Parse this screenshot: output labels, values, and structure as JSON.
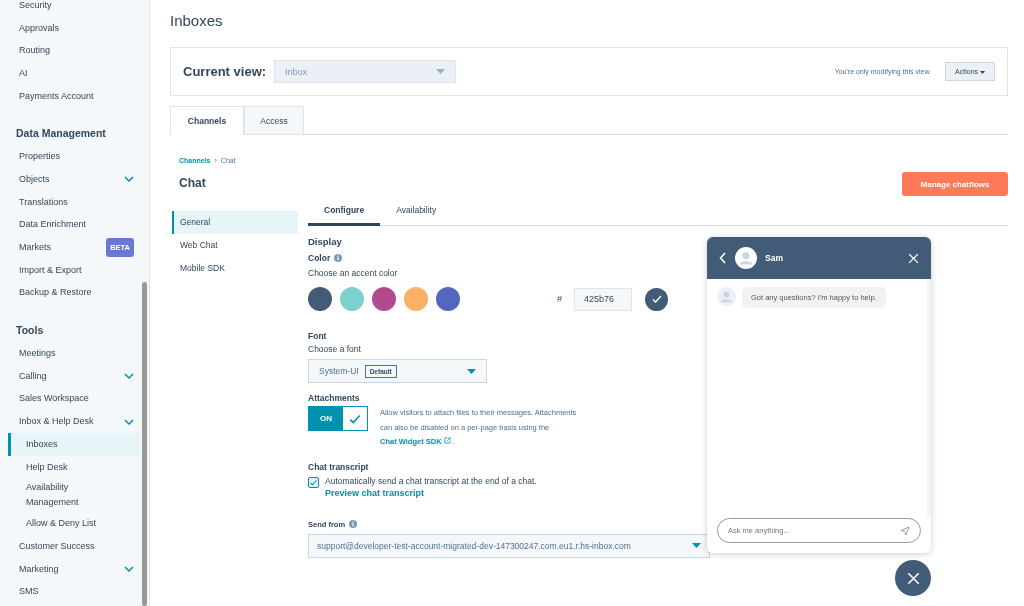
{
  "sidebar": {
    "sections": [
      {
        "items": [
          {
            "label": "Security",
            "expandable": false,
            "selected": false
          },
          {
            "label": "Approvals",
            "expandable": false,
            "selected": false
          },
          {
            "label": "Routing",
            "expandable": false,
            "selected": false
          },
          {
            "label": "AI",
            "expandable": false,
            "selected": false
          },
          {
            "label": "Payments Account",
            "expandable": false,
            "selected": false
          }
        ]
      },
      {
        "heading": "Data Management",
        "items": [
          {
            "label": "Properties",
            "expandable": false,
            "selected": false
          },
          {
            "label": "Objects",
            "expandable": true,
            "selected": false
          },
          {
            "label": "Translations",
            "expandable": false,
            "selected": false
          },
          {
            "label": "Data Enrichment",
            "expandable": false,
            "selected": false
          },
          {
            "label": "Markets",
            "badge": "BETA",
            "expandable": false,
            "selected": false
          },
          {
            "label": "Import & Export",
            "expandable": false,
            "selected": false
          },
          {
            "label": "Backup & Restore",
            "expandable": false,
            "selected": false
          }
        ]
      },
      {
        "heading": "Tools",
        "items": [
          {
            "label": "Meetings",
            "expandable": false,
            "selected": false
          },
          {
            "label": "Calling",
            "expandable": true,
            "selected": false
          },
          {
            "label": "Sales Workspace",
            "expandable": false,
            "selected": false
          },
          {
            "label": "Inbox & Help Desk",
            "expandable": true,
            "selected": false,
            "children": [
              {
                "label": "Inboxes",
                "selected": true
              },
              {
                "label": "Help Desk",
                "selected": false
              },
              {
                "label": "Availability Management",
                "selected": false
              },
              {
                "label": "Allow & Deny List",
                "selected": false
              }
            ]
          },
          {
            "label": "Customer Success",
            "expandable": false,
            "selected": false
          },
          {
            "label": "Marketing",
            "expandable": true,
            "selected": false
          },
          {
            "label": "SMS",
            "expandable": false,
            "selected": false
          }
        ]
      }
    ]
  },
  "page_title": "Inboxes",
  "view_bar": {
    "label": "Current view:",
    "select_value": "Inbox",
    "note": "You're only modifying this view.",
    "actions": "Actions"
  },
  "tabs": [
    {
      "label": "Channels",
      "selected": true
    },
    {
      "label": "Access",
      "selected": false
    }
  ],
  "breadcrumb": {
    "link": "Channels",
    "separator": "›",
    "current": "Chat"
  },
  "title": "Chat",
  "manage_button": "Manage chatflows",
  "subnav": [
    {
      "label": "General",
      "selected": true
    },
    {
      "label": "Web Chat",
      "selected": false
    },
    {
      "label": "Mobile SDK",
      "selected": false
    }
  ],
  "config_tabs": [
    {
      "label": "Configure",
      "selected": true
    },
    {
      "label": "Availability",
      "selected": false
    }
  ],
  "display": {
    "heading": "Display",
    "color_label": "Color",
    "color_hint": "Choose an accent color",
    "swatches": [
      {
        "color": "#425b76"
      },
      {
        "color": "#7fd1cf"
      },
      {
        "color": "#b24a8e"
      },
      {
        "color": "#fbb06a"
      },
      {
        "color": "#5467c0"
      }
    ],
    "hash": "#",
    "hex_value": "425b76",
    "font_label": "Font",
    "font_hint": "Choose a font",
    "font_value": "System-UI",
    "font_badge": "Default"
  },
  "attachments": {
    "heading": "Attachments",
    "toggle_label": "ON",
    "on": true,
    "text": "Allow visitors to attach files to their messages. Attachments can also be disabled on a per-page basis using the",
    "link": "Chat Widget SDK",
    "after": "."
  },
  "transcript": {
    "heading": "Chat transcript",
    "checked": true,
    "text": "Automatically send a chat transcript at the end of a chat.",
    "link": "Preview chat transcript"
  },
  "send_from": {
    "label": "Send from",
    "value": "support@developer-test-account-migrated-dev-147300247.com.eu1.r.hs-inbox.com"
  },
  "chat_preview": {
    "agent": "Sam",
    "message": "Got any questions? I'm happy to help.",
    "placeholder": "Ask me anything..."
  }
}
